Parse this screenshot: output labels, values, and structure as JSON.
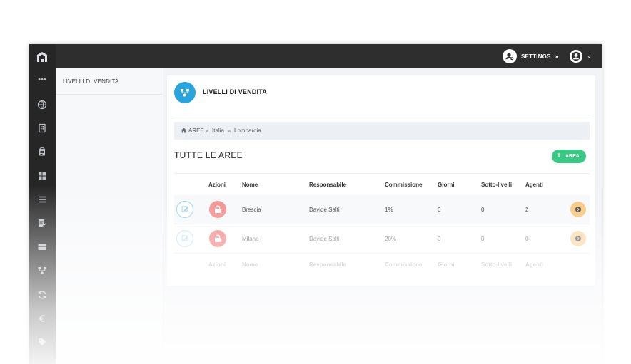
{
  "topbar": {
    "settings_label": "SETTINGS",
    "settings_chevron": "»",
    "user_caret": "⌄"
  },
  "rail": {
    "dots": "•••",
    "icons": [
      "globe-icon",
      "building-icon",
      "clipboard-icon",
      "grid-icon",
      "list-icon",
      "edit-doc-icon",
      "card-icon",
      "hierarchy-icon",
      "refresh-icon",
      "euro-icon",
      "tag-icon"
    ]
  },
  "left_menu": {
    "active_item": "LIVELLI DI VENDITA"
  },
  "card": {
    "title": "LIVELLI DI VENDITA",
    "breadcrumb": {
      "home": "AREE",
      "level1": "Italia",
      "level2": "Lombardia"
    },
    "section_title": "TUTTE LE AREE",
    "add_button": "AREA"
  },
  "table": {
    "headers": [
      "Azioni",
      "Nome",
      "Responsabile",
      "Commissione",
      "Giorni",
      "Sotto-livelli",
      "Agenti"
    ],
    "rows": [
      {
        "nome": "Brescia",
        "responsabile": "Davide Salti",
        "commissione": "1%",
        "giorni": "0",
        "sotto_livelli": "0",
        "agenti": "2"
      },
      {
        "nome": "Milano",
        "responsabile": "Davide Salti",
        "commissione": "20%",
        "giorni": "0",
        "sotto_livelli": "0",
        "agenti": "0"
      }
    ]
  },
  "colors": {
    "accent_blue": "#2aa4df",
    "add_green": "#3ac985",
    "lock_red": "#f28b8b",
    "go_orange": "#f7c57c",
    "topbar": "#2e2e2e"
  }
}
